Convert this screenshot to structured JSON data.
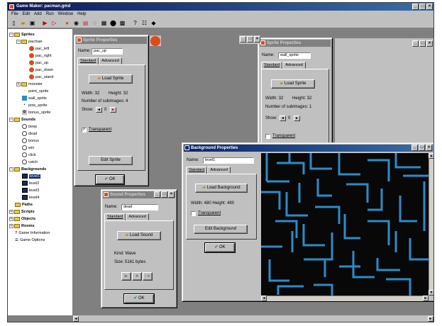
{
  "app": {
    "title": "Game Maker: pacman.gmd"
  },
  "menu": [
    "File",
    "Edit",
    "Add",
    "Run",
    "Window",
    "Help"
  ],
  "toolbar_icons": [
    "new-icon",
    "open-icon",
    "save-icon",
    "run-icon",
    "run-debug-icon",
    "add-sprite-icon",
    "add-sound-icon",
    "add-background-icon",
    "add-path-icon",
    "add-script-icon",
    "add-object-icon",
    "add-room-icon",
    "help-icon",
    "game-settings-icon",
    "game-info-icon"
  ],
  "tree": {
    "sprites": "Sprites",
    "pacman": "pacman",
    "pac_items": [
      "pac_left",
      "pac_right",
      "pac_up",
      "pac_down",
      "pac_stand"
    ],
    "monster": "monster",
    "sprite_items": [
      "point_sprite",
      "wall_sprite",
      "pow_sprite",
      "bonus_sprite"
    ],
    "sounds": "Sounds",
    "sound_items": [
      "beep",
      "dead",
      "bonus",
      "win",
      "click",
      "catch"
    ],
    "backgrounds": "Backgrounds",
    "bg_items": [
      "level1",
      "level2",
      "level3",
      "level4"
    ],
    "paths": "Paths",
    "scripts": "Scripts",
    "objects": "Objects",
    "rooms": "Rooms",
    "info": "Game Information",
    "options": "Game Options"
  },
  "sprite1": {
    "title": "Sprite Properties",
    "name_label": "Name:",
    "name_value": "pac_up",
    "tab1": "Standard",
    "tab2": "Advanced",
    "load": "Load Sprite",
    "width": "Width: 32",
    "height": "Height: 32",
    "subimages": "Number of subimages: 4",
    "show": "Show:",
    "show_value": "0",
    "transparent": "Transparent",
    "edit": "Edit Sprite",
    "ok": "OK"
  },
  "sprite2": {
    "title": "Sprite Properties",
    "name_label": "Name:",
    "name_value": "wall_sprite",
    "tab1": "Standard",
    "tab2": "Advanced",
    "load": "Load Sprite",
    "width": "Width: 32",
    "height": "Height: 32",
    "subimages": "Number of subimages: 1",
    "show": "Show:",
    "show_value": "0",
    "transparent": "Transparent"
  },
  "sound": {
    "title": "Sound Properties",
    "name_label": "Name:",
    "name_value": "dead",
    "tab1": "Standard",
    "tab2": "Advanced",
    "load": "Load Sound",
    "kind": "Kind: Wave",
    "size": "Size: 5161 bytes",
    "ok": "OK"
  },
  "background": {
    "title": "Background Properties",
    "name_label": "Name:",
    "name_value": "level1",
    "tab1": "Standard",
    "tab2": "Advanced",
    "load": "Load Background",
    "size": "Width: 480    Height: 480",
    "transparent": "Transparent",
    "edit": "Edit Background",
    "ok": "OK"
  },
  "colors": {
    "maze_bg": "#080808",
    "maze_wall": "#2c8bc9",
    "pacman": "#e04a18",
    "title_active": "#0a246a"
  }
}
